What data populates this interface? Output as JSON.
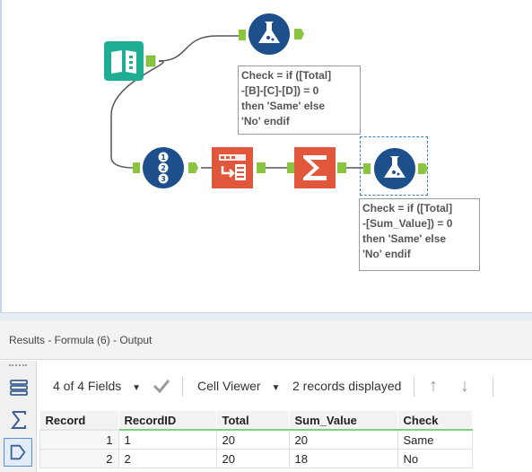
{
  "canvas": {
    "annotations": [
      "Check = if ([Total]\n-[B]-[C]-[D]) = 0\nthen 'Same' else\n'No' endif",
      "Check = if ([Total]\n-[Sum_Value]) = 0\nthen 'Same' else\n'No' endif"
    ],
    "tools": [
      "input-book",
      "formula",
      "record-id",
      "select",
      "summarize",
      "formula-selected"
    ]
  },
  "results": {
    "title": "Results - Formula (6) - Output",
    "fields_label": "4 of 4 Fields",
    "viewer_label": "Cell Viewer",
    "records_label": "2 records displayed"
  },
  "grid": {
    "headers": [
      "Record",
      "RecordID",
      "Total",
      "Sum_Value",
      "Check"
    ],
    "rows": [
      [
        "1",
        "1",
        "20",
        "20",
        "Same"
      ],
      [
        "2",
        "2",
        "20",
        "18",
        "No"
      ]
    ]
  },
  "colors": {
    "input_tool": "#1fae93",
    "formula_tool": "#1c4f8c",
    "transform_tool": "#e0573c",
    "connector": "#8bc53f",
    "wire": "#555555"
  }
}
